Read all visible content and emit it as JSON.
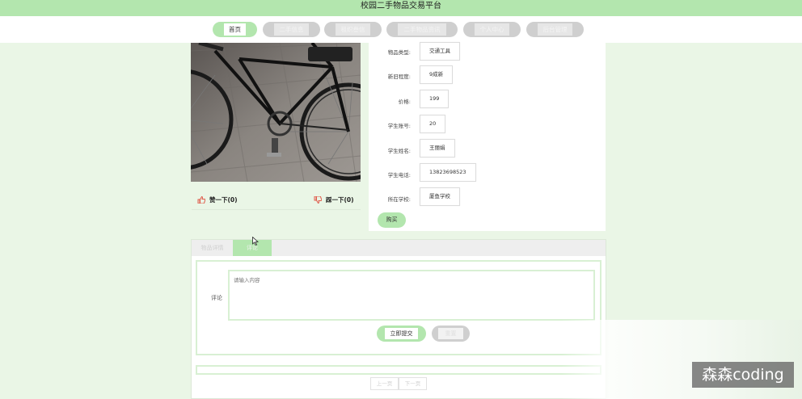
{
  "header": {
    "title": "校园二手物品交易平台"
  },
  "nav": {
    "items": [
      {
        "label": "首页",
        "active": true
      },
      {
        "label": "二手信息",
        "active": false
      },
      {
        "label": "租织叁信",
        "active": false
      },
      {
        "label": "二手物品资讯",
        "active": false
      },
      {
        "label": "个人中心",
        "active": false
      },
      {
        "label": "后台管理",
        "active": false
      }
    ]
  },
  "item": {
    "image": "bicycle-photo",
    "like_label": "赞一下(0)",
    "dislike_label": "踩一下(0)",
    "fields": [
      {
        "label": "物品类型:",
        "value": "交通工具"
      },
      {
        "label": "新旧程度:",
        "value": "9成新"
      },
      {
        "label": "价格:",
        "value": "199"
      },
      {
        "label": "学生账号:",
        "value": "20"
      },
      {
        "label": "学生姓名:",
        "value": "王丽娟"
      },
      {
        "label": "学生电话:",
        "value": "13823698523"
      },
      {
        "label": "所在学校:",
        "value": "厦鱼学校"
      }
    ],
    "buy_label": "购买"
  },
  "comments": {
    "tabs": [
      {
        "label": "物品详情",
        "active": false
      },
      {
        "label": "评论",
        "active": true
      }
    ],
    "field_label": "评论",
    "placeholder": "请输入内容",
    "submit_label": "立即提交",
    "reset_label": "重置",
    "prev_label": "上一页",
    "next_label": "下一页"
  },
  "watermark": "森森coding",
  "colors": {
    "accent": "#b3e6ae",
    "page_bg": "#eaf6e6",
    "like": "#e05a4a"
  }
}
